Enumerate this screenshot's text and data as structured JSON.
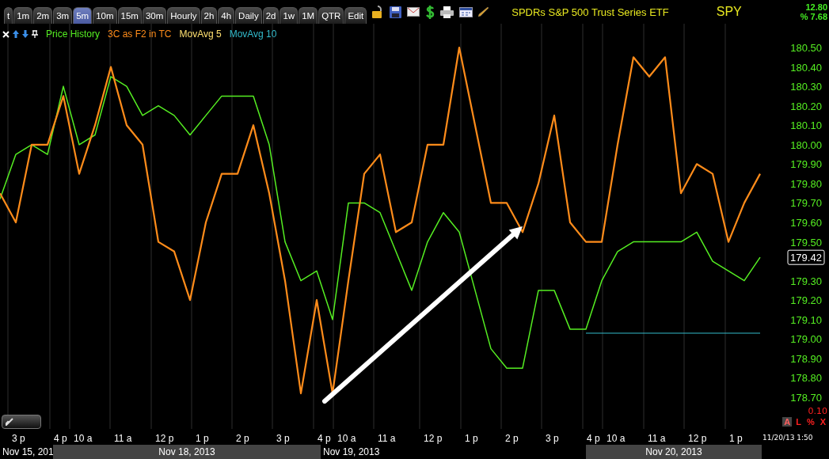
{
  "toolbar": {
    "tabs": [
      {
        "label": "t",
        "selected": false
      },
      {
        "label": "1m",
        "selected": false
      },
      {
        "label": "2m",
        "selected": false
      },
      {
        "label": "3m",
        "selected": false
      },
      {
        "label": "5m",
        "selected": true
      },
      {
        "label": "10m",
        "selected": false
      },
      {
        "label": "15m",
        "selected": false
      },
      {
        "label": "30m",
        "selected": false
      },
      {
        "label": "Hourly",
        "selected": false
      },
      {
        "label": "2h",
        "selected": false
      },
      {
        "label": "4h",
        "selected": false
      },
      {
        "label": "Daily",
        "selected": false
      },
      {
        "label": "2d",
        "selected": false
      },
      {
        "label": "1w",
        "selected": false
      },
      {
        "label": "1M",
        "selected": false
      },
      {
        "label": "QTR",
        "selected": false
      },
      {
        "label": "Edit",
        "selected": false
      }
    ],
    "title": "SPDRs S&P 500 Trust Series ETF",
    "symbol": "SPY",
    "change": "12.80",
    "change_pct": "% 7.68"
  },
  "legend": {
    "items": [
      {
        "label": "MovAvg 5",
        "color": "#ffe070"
      }
    ]
  },
  "chart": {
    "time_labels": [
      "3 p",
      "4 p",
      "10 a",
      "11 a",
      "12 p",
      "1 p",
      "2 p",
      "3 p",
      "4 p",
      "10 a",
      "11 a",
      "12 p",
      "1 p",
      "2 p",
      "3 p",
      "4 p",
      "10 a",
      "11 a",
      "12 p",
      "1 p"
    ],
    "chart_data": {
      "type": "line",
      "grid": true,
      "yticks": [
        {
          "value": 180.5,
          "label": "180.50"
        },
        {
          "value": 180.4,
          "label": "180.40"
        },
        {
          "value": 180.3,
          "label": "180.30"
        },
        {
          "value": 180.2,
          "label": "180.20"
        },
        {
          "value": 180.1,
          "label": "180.10"
        },
        {
          "value": 180.0,
          "label": "180.00"
        },
        {
          "value": 179.9,
          "label": "179.90"
        },
        {
          "value": 179.8,
          "label": "179.80"
        },
        {
          "value": 179.7,
          "label": "179.70"
        },
        {
          "value": 179.6,
          "label": "179.60"
        },
        {
          "value": 179.5,
          "label": "179.50"
        },
        {
          "value": 179.3,
          "label": "179.30"
        },
        {
          "value": 179.2,
          "label": "179.20"
        },
        {
          "value": 179.1,
          "label": "179.10"
        },
        {
          "value": 179.0,
          "label": "179.00"
        },
        {
          "value": 178.9,
          "label": "178.90"
        },
        {
          "value": 178.8,
          "label": "178.80"
        },
        {
          "value": 178.7,
          "label": "178.70"
        }
      ],
      "ylim": [
        178.7,
        180.5
      ],
      "series": [
        {
          "name": "Price History",
          "color": "#55ee22",
          "values": [
            179.72,
            179.95,
            180.0,
            179.95,
            180.3,
            180.0,
            180.05,
            180.35,
            180.3,
            180.15,
            180.2,
            180.15,
            180.05,
            180.15,
            180.25,
            180.25,
            180.25,
            180.0,
            179.5,
            179.3,
            179.35,
            179.1,
            179.7,
            179.7,
            179.65,
            179.45,
            179.25,
            179.5,
            179.65,
            179.55,
            179.25,
            178.95,
            178.85,
            178.85,
            179.25,
            179.25,
            179.05,
            179.05,
            179.3,
            179.45,
            179.5,
            179.5,
            179.5,
            179.5,
            179.55,
            179.4,
            179.35,
            179.3,
            179.42
          ]
        },
        {
          "name": "3C as F2 in TC",
          "color": "#ff8c1a",
          "values": [
            179.75,
            179.6,
            180.0,
            180.0,
            180.25,
            179.85,
            180.1,
            180.4,
            180.1,
            180.0,
            179.5,
            179.45,
            179.2,
            179.6,
            179.85,
            179.85,
            180.1,
            179.75,
            179.3,
            178.72,
            179.2,
            178.72,
            179.3,
            179.85,
            179.95,
            179.55,
            179.6,
            180.0,
            180.0,
            180.5,
            180.1,
            179.7,
            179.7,
            179.55,
            179.8,
            180.15,
            179.6,
            179.5,
            179.5,
            180.0,
            180.45,
            180.35,
            180.45,
            179.75,
            179.9,
            179.85,
            179.5,
            179.7,
            179.85
          ]
        },
        {
          "name": "MovAvg 10",
          "color": "#33bbcc",
          "values": [
            null,
            null,
            null,
            null,
            null,
            null,
            null,
            null,
            null,
            null,
            null,
            null,
            null,
            null,
            null,
            null,
            null,
            null,
            null,
            null,
            null,
            null,
            null,
            null,
            null,
            null,
            null,
            null,
            null,
            null,
            null,
            null,
            null,
            null,
            null,
            null,
            null,
            179.03,
            179.03,
            179.03,
            179.03,
            179.03,
            179.03,
            179.03,
            179.03,
            179.03,
            179.03,
            179.03,
            179.03
          ]
        }
      ]
    },
    "current_price": "179.42",
    "scale_label": "0.10",
    "scale_buttons": [
      {
        "label": "A",
        "selected": true
      },
      {
        "label": "L",
        "selected": false
      },
      {
        "label": "%",
        "selected": false
      },
      {
        "label": "X",
        "selected": false
      }
    ],
    "timestamp": "11/20/13 1:50"
  },
  "dates": [
    {
      "label": "Nov 15, 201",
      "shaded": false
    },
    {
      "label": "Nov 18, 2013",
      "shaded": true
    },
    {
      "label": "Nov 19, 2013",
      "shaded": false
    },
    {
      "label": "Nov 20, 2013",
      "shaded": true
    }
  ]
}
